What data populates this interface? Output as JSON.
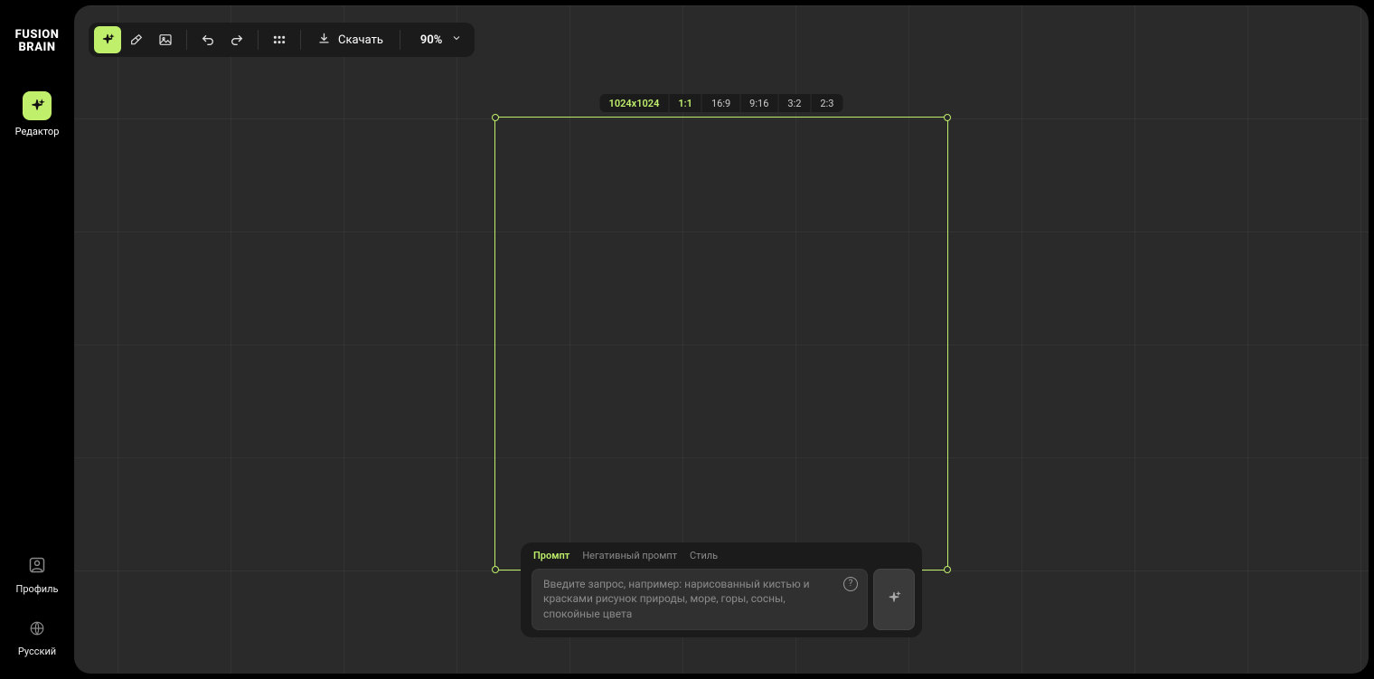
{
  "brand": {
    "line1": "FUSION",
    "line2": "BRAIN"
  },
  "sidebar": {
    "editor_label": "Редактор",
    "profile_label": "Профиль",
    "language_label": "Русский"
  },
  "toolbar": {
    "download_label": "Скачать",
    "zoom_label": "90%"
  },
  "ratios": {
    "size_label": "1024x1024",
    "items": [
      "1:1",
      "16:9",
      "9:16",
      "3:2",
      "2:3"
    ],
    "active_index": 0
  },
  "prompt": {
    "tabs": {
      "prompt": "Промпт",
      "negative": "Негативный промпт",
      "style": "Стиль"
    },
    "placeholder": "Введите запрос, например: нарисованный кистью и красками рисунок природы, море, горы, сосны, спокойные цвета",
    "help_glyph": "?"
  },
  "colors": {
    "accent": "#bfef6b"
  }
}
